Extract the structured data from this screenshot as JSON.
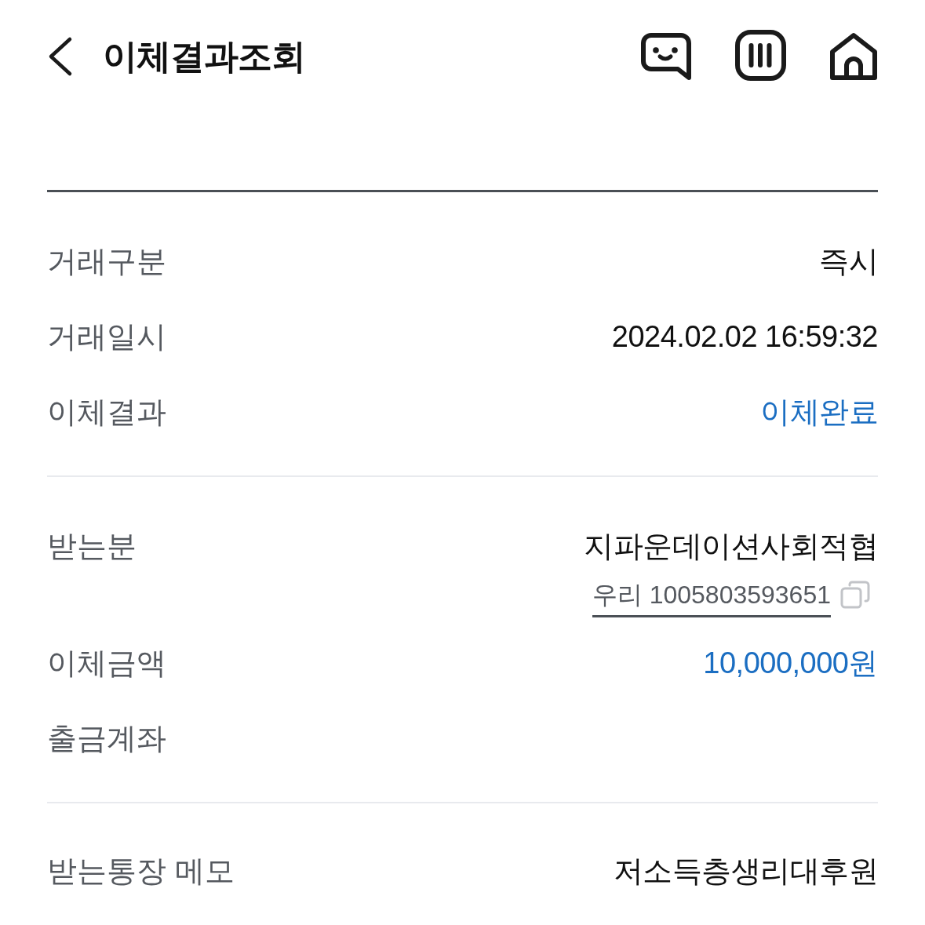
{
  "header": {
    "title": "이체결과조회"
  },
  "sections": [
    {
      "rows": [
        {
          "label": "거래구분",
          "value": "즉시",
          "kind": "plain"
        },
        {
          "label": "거래일시",
          "value": "2024.02.02 16:59:32",
          "kind": "plain"
        },
        {
          "label": "이체결과",
          "value": "이체완료",
          "kind": "accent"
        }
      ]
    },
    {
      "rows": [
        {
          "label": "받는분",
          "value": "지파운데이션사회적협",
          "kind": "plain",
          "account": "우리 1005803593651"
        },
        {
          "label": "이체금액",
          "value": "10,000,000원",
          "kind": "accent"
        },
        {
          "label": "출금계좌"
        }
      ]
    },
    {
      "rows": [
        {
          "label": "받는통장 메모",
          "value": "저소득층생리대후원",
          "kind": "plain"
        }
      ]
    }
  ]
}
